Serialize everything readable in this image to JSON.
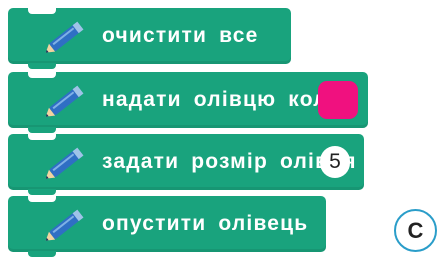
{
  "blocks": [
    {
      "label": "очистити все",
      "icon": "pencil-icon"
    },
    {
      "label": "надати олівцю колір",
      "icon": "pencil-icon",
      "color": "#f0117f"
    },
    {
      "label": "задати розмір олівця",
      "icon": "pencil-icon",
      "value": "5"
    },
    {
      "label": "опустити олівець",
      "icon": "pencil-icon"
    }
  ],
  "badge": {
    "letter": "С"
  },
  "colors": {
    "block": "#19a37d",
    "badge_border": "#2a9dc9",
    "pen_color": "#f0117f"
  }
}
